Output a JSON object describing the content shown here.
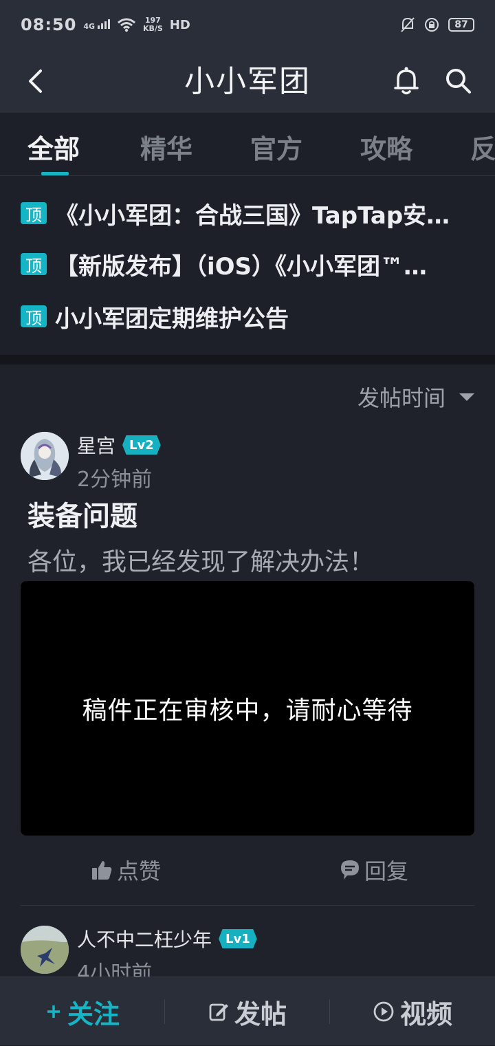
{
  "status_bar": {
    "time": "08:50",
    "network": "4G",
    "speed_value": "197",
    "speed_unit": "KB/S",
    "hd": "HD",
    "battery": "87"
  },
  "header": {
    "title": "小小军团",
    "icons": [
      "back-arrow-icon",
      "bell-icon",
      "search-icon"
    ]
  },
  "tabs": [
    {
      "label": "全部",
      "active": true
    },
    {
      "label": "精华",
      "active": false
    },
    {
      "label": "官方",
      "active": false
    },
    {
      "label": "攻略",
      "active": false
    },
    {
      "label": "反",
      "active": false
    }
  ],
  "pinned": {
    "badge": "顶",
    "items": [
      {
        "title": "《小小军团：合战三国》TapTap安…"
      },
      {
        "title": "【新版发布】（iOS）《小小军团™…"
      },
      {
        "title": "小小军团定期维护公告"
      }
    ]
  },
  "feed": {
    "sort_label": "发帖时间",
    "posts": [
      {
        "author": "星宫",
        "level": "Lv2",
        "time": "2分钟前",
        "title": "装备问题",
        "summary": "各位，我已经发现了解决办法！",
        "media_notice": "稿件正在审核中，请耐心等待",
        "like_label": "点赞",
        "reply_label": "回复"
      },
      {
        "author": "人不中二枉少年",
        "level": "Lv1",
        "time": "4小时前"
      }
    ]
  },
  "bottom_bar": {
    "follow": "关注",
    "post": "发帖",
    "video": "视频"
  },
  "colors": {
    "accent": "#15b5c5",
    "header_bg": "#2a2e38",
    "content_bg": "#1f222b"
  }
}
